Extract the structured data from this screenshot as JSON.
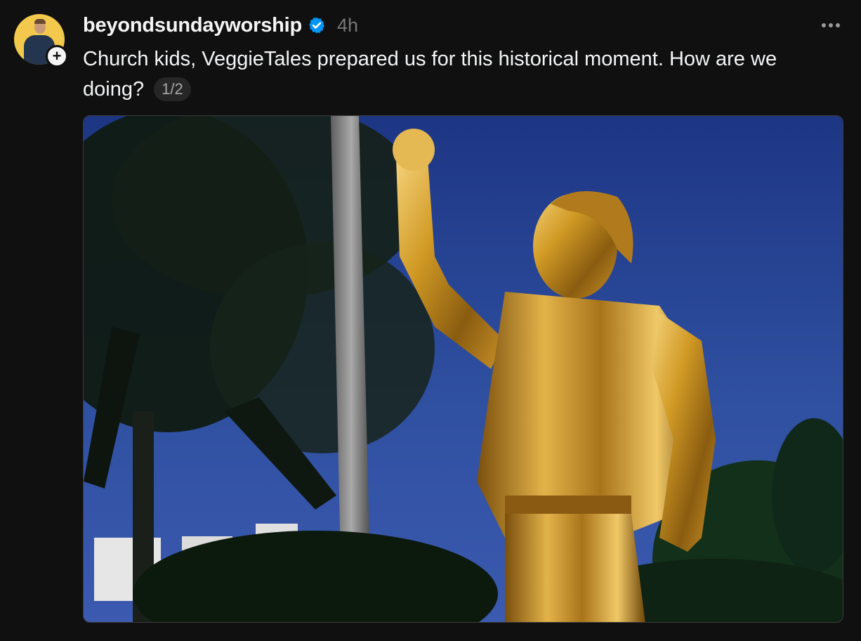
{
  "post": {
    "username": "beyondsundayworship",
    "time": "4h",
    "caption": "Church kids, VeggieTales prepared us for this historical moment. How are we doing?",
    "media_counter": "1/2",
    "follow_symbol": "+"
  },
  "icons": {
    "verified": "verified-badge-icon",
    "more": "more-options-icon",
    "follow": "plus-icon"
  },
  "colors": {
    "background": "#101010",
    "verified_blue": "#0095f6",
    "muted_text": "#777777",
    "statue_gold": "#d8a52a",
    "sky_blue": "#2c4c9a"
  }
}
